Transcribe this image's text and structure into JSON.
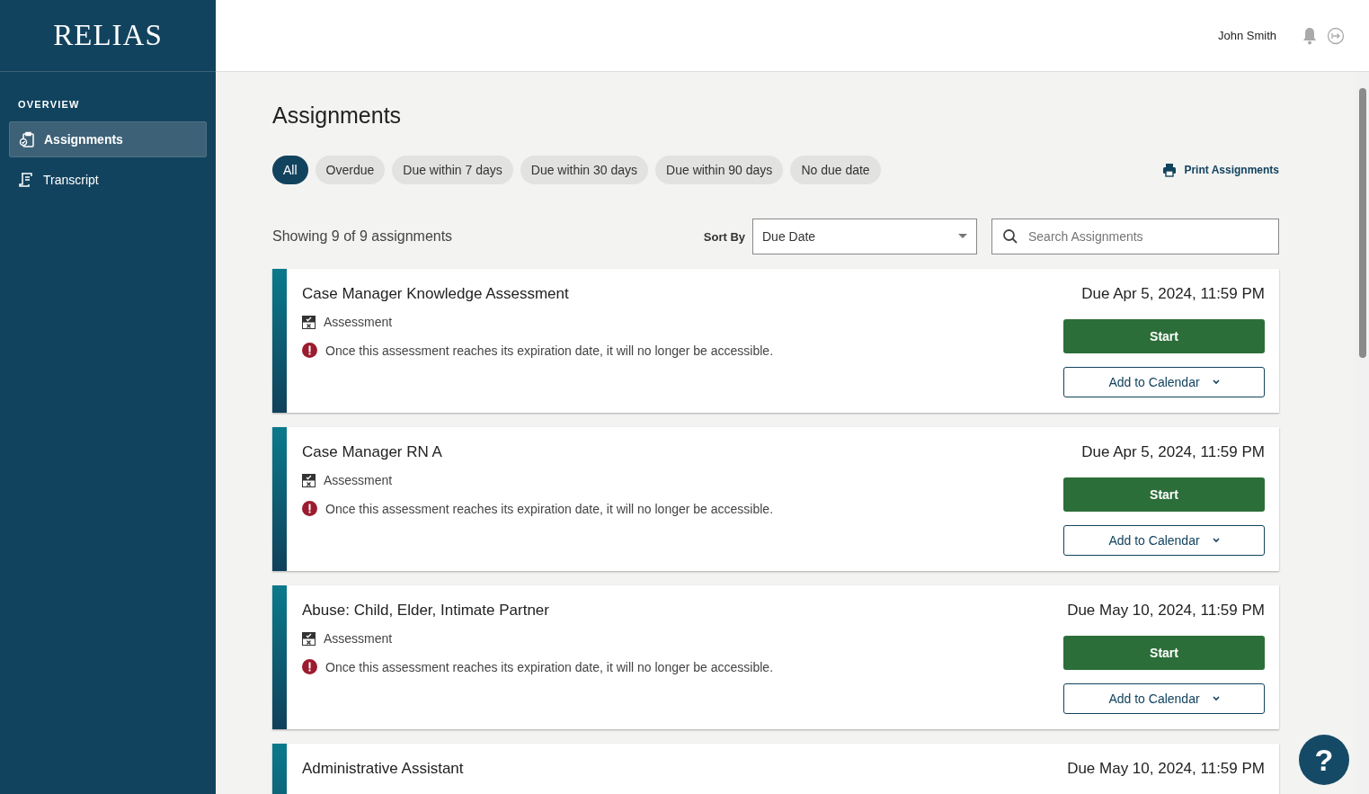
{
  "sidebar": {
    "logo": "RELIAS",
    "section": "OVERVIEW",
    "items": [
      {
        "label": "Assignments",
        "selected": true
      },
      {
        "label": "Transcript",
        "selected": false
      }
    ]
  },
  "header": {
    "user": "John Smith"
  },
  "page": {
    "title": "Assignments",
    "filters": [
      {
        "label": "All",
        "selected": true
      },
      {
        "label": "Overdue",
        "selected": false
      },
      {
        "label": "Due within 7 days",
        "selected": false
      },
      {
        "label": "Due within 30 days",
        "selected": false
      },
      {
        "label": "Due within 90 days",
        "selected": false
      },
      {
        "label": "No due date",
        "selected": false
      }
    ],
    "print": "Print Assignments",
    "count": "Showing 9 of 9 assignments",
    "sort": {
      "label": "Sort By",
      "value": "Due Date"
    },
    "search": {
      "placeholder": "Search Assignments"
    },
    "assignments": [
      {
        "title": "Case Manager Knowledge Assessment",
        "type": "Assessment",
        "warning": "Once this assessment reaches its expiration date, it will no longer be accessible.",
        "due": "Due Apr 5, 2024, 11:59 PM",
        "start": "Start",
        "calendar": "Add to Calendar"
      },
      {
        "title": "Case Manager RN A",
        "type": "Assessment",
        "warning": "Once this assessment reaches its expiration date, it will no longer be accessible.",
        "due": "Due Apr 5, 2024, 11:59 PM",
        "start": "Start",
        "calendar": "Add to Calendar"
      },
      {
        "title": "Abuse: Child, Elder, Intimate Partner",
        "type": "Assessment",
        "warning": "Once this assessment reaches its expiration date, it will no longer be accessible.",
        "due": "Due May 10, 2024, 11:59 PM",
        "start": "Start",
        "calendar": "Add to Calendar"
      },
      {
        "title": "Administrative Assistant",
        "due": "Due May 10, 2024, 11:59 PM"
      }
    ]
  },
  "help": "?"
}
